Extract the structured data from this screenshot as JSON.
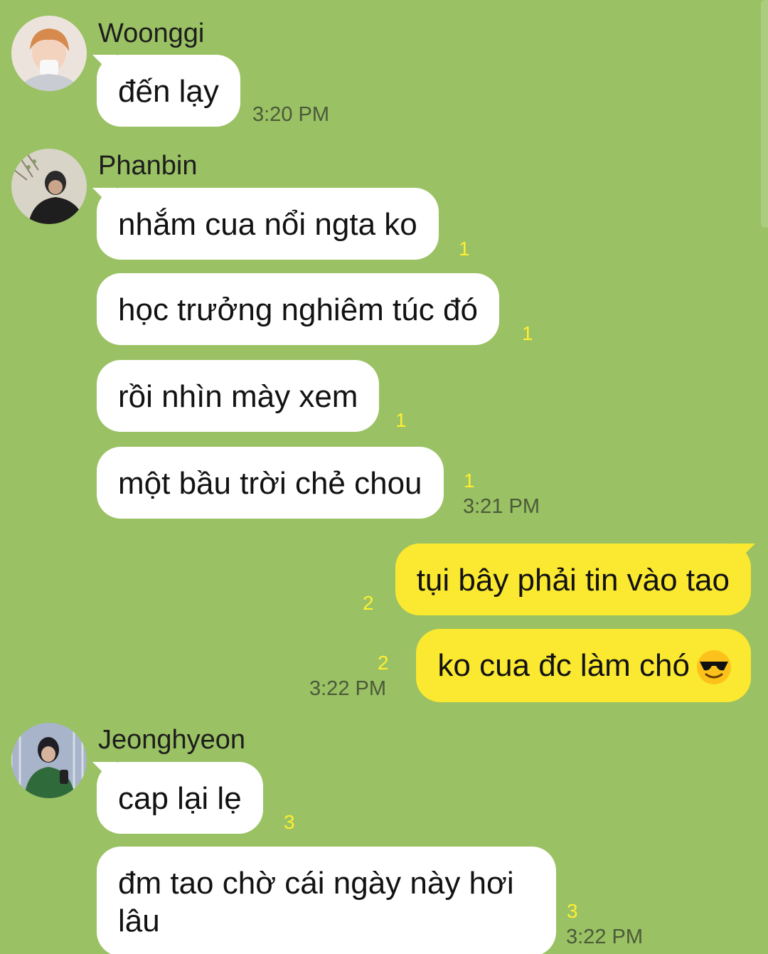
{
  "messages": [
    {
      "sender": "Woonggi",
      "text": "đến lạy",
      "time": "3:20 PM"
    },
    {
      "sender": "Phanbin",
      "text": "nhắm cua nổi ngta ko",
      "unread": "1"
    },
    {
      "text": "học trưởng nghiêm túc đó",
      "unread": "1"
    },
    {
      "text": "rồi nhìn mày xem",
      "unread": "1"
    },
    {
      "text": "một bầu trời chẻ chou",
      "unread": "1",
      "time": "3:21 PM"
    },
    {
      "text": "tụi bây phải tin vào tao",
      "unread": "2",
      "mine": true
    },
    {
      "text": "ko cua đc làm chó",
      "emoji": "smiling-face-with-sunglasses-icon",
      "unread": "2",
      "time": "3:22 PM",
      "mine": true
    },
    {
      "sender": "Jeonghyeon",
      "text": "cap lại lẹ",
      "unread": "3"
    },
    {
      "text_line1": "đm tao chờ cái ngày này hơi",
      "text_line2": "lâu",
      "unread": "3",
      "time": "3:22 PM"
    }
  ],
  "colors": {
    "background": "#9ac163",
    "incoming_bubble": "#ffffff",
    "outgoing_bubble": "#fbe830",
    "unread_count": "#ffee33",
    "timestamp": "#4b5a3a"
  }
}
